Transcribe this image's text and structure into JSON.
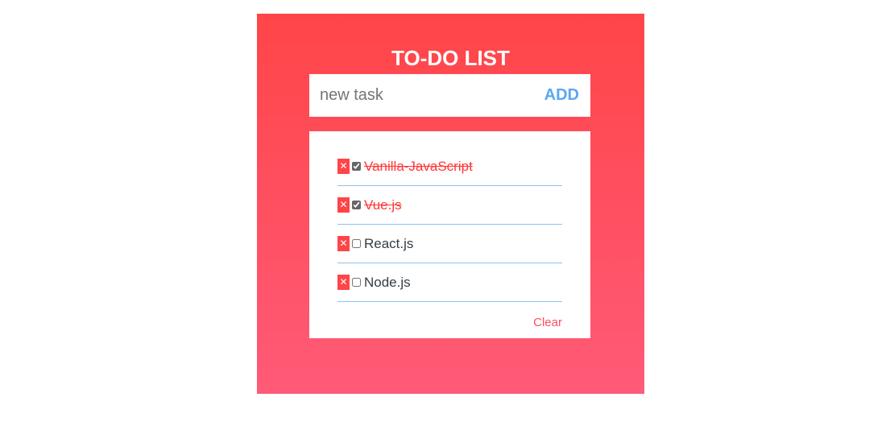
{
  "app": {
    "title": "TO-DO LIST"
  },
  "input": {
    "placeholder": "new task",
    "value": "",
    "add_label": "ADD"
  },
  "tasks": [
    {
      "label": "Vanilla-JavaScript",
      "done": true,
      "delete_glyph": "✕"
    },
    {
      "label": "Vue.js",
      "done": true,
      "delete_glyph": "✕"
    },
    {
      "label": "React.js",
      "done": false,
      "delete_glyph": "✕"
    },
    {
      "label": "Node.js",
      "done": false,
      "delete_glyph": "✕"
    }
  ],
  "footer": {
    "clear_label": "Clear"
  },
  "colors": {
    "gradient_top": "#ff4548",
    "gradient_bottom": "#ff5a78",
    "accent_blue": "#5ba7f2",
    "done_red": "#ff3838",
    "divider_blue": "#8cc4f0"
  }
}
